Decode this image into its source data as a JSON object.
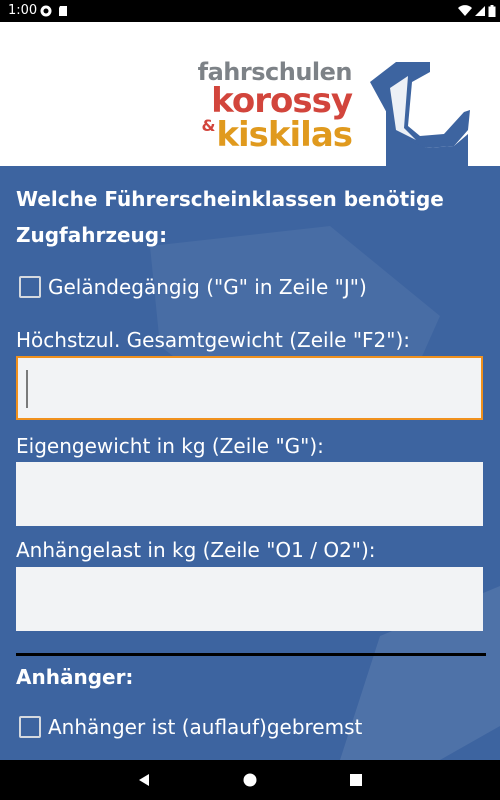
{
  "status_bar": {
    "time": "1:00",
    "icons": [
      "notification-icon",
      "sd-card-icon",
      "wifi-icon",
      "signal-icon",
      "battery-icon"
    ]
  },
  "header": {
    "logo": {
      "line1": "fahrschulen",
      "line2": "korossy",
      "ampersand": "&",
      "line3": "kiskilas",
      "colors": {
        "gray": "#7d8287",
        "red": "#d2453c",
        "orange": "#e09a1e",
        "blue": "#3d64a0"
      }
    }
  },
  "form": {
    "heading_line1": "Welche Führerscheinklassen benötige",
    "heading_line2": "Zugfahrzeug:",
    "offroad_checkbox": {
      "label": "Geländegängig (\"G\" in Zeile \"J\")",
      "checked": false
    },
    "max_weight": {
      "label": "Höchstzul. Gesamtgewicht (Zeile \"F2\"):",
      "value": ""
    },
    "own_weight": {
      "label": "Eigengewicht in kg (Zeile \"G\"):",
      "value": ""
    },
    "trailer_load": {
      "label": "Anhängelast in kg  (Zeile \"O1 / O2\"):",
      "value": ""
    },
    "trailer_heading": "Anhänger:",
    "braked_checkbox": {
      "label": "Anhänger ist (auflauf)gebremst",
      "checked": false
    }
  },
  "colors": {
    "background": "#3d64a0",
    "focus": "#f0911e",
    "input": "#f2f3f5"
  },
  "nav_bar": {
    "buttons": [
      "back-icon",
      "home-icon",
      "recents-icon"
    ]
  }
}
